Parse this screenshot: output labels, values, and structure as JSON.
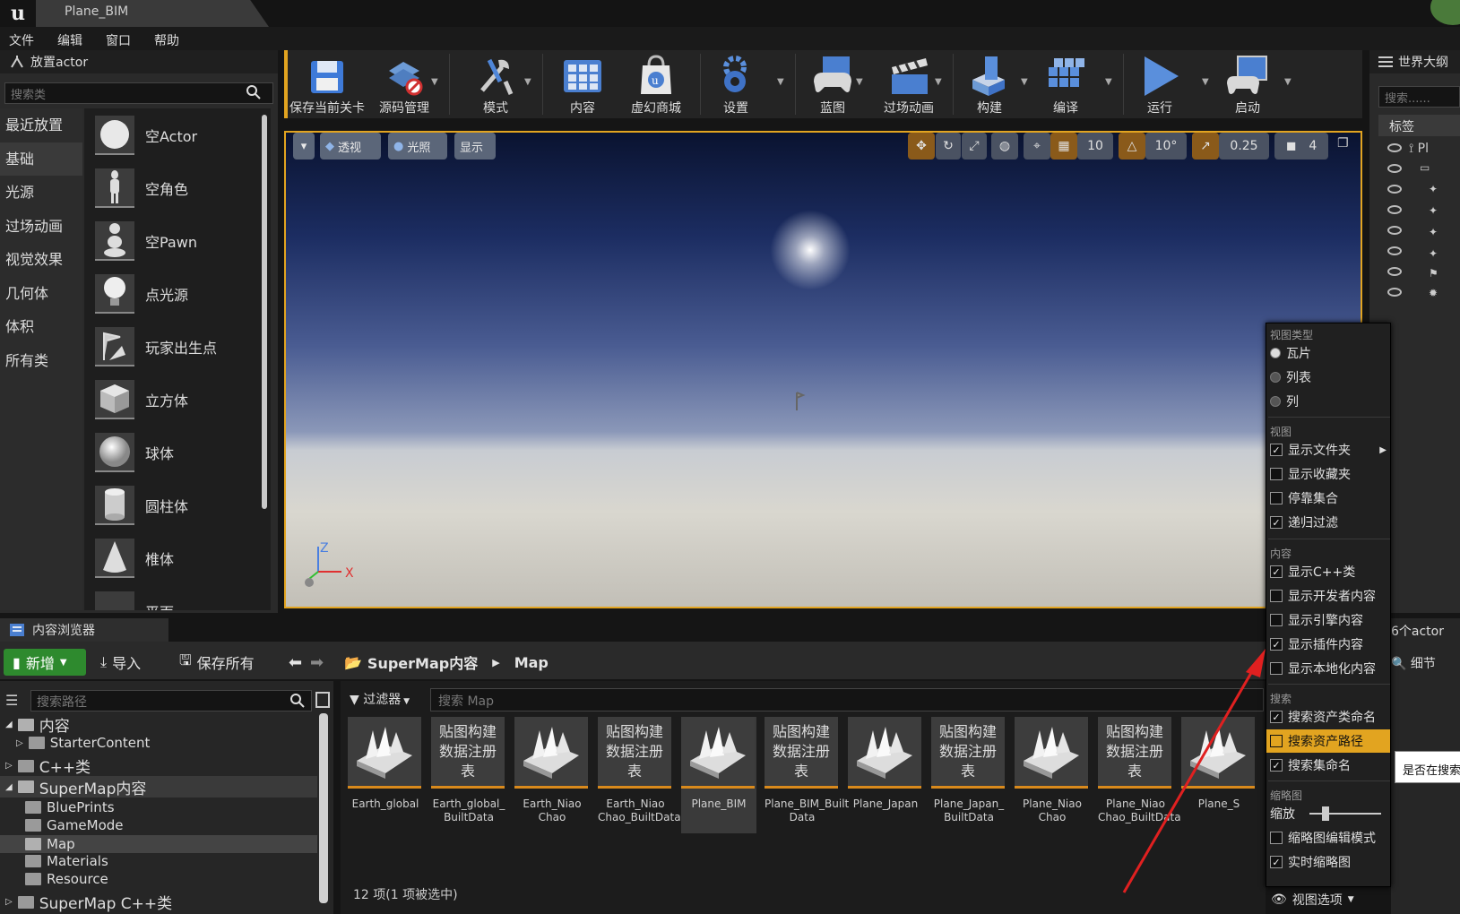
{
  "title": {
    "logo": "u",
    "tab": "Plane_BIM"
  },
  "menu": [
    "文件",
    "编辑",
    "窗口",
    "帮助"
  ],
  "place_actor": {
    "tab": "放置actor",
    "search_placeholder": "搜索类",
    "categories": [
      "最近放置",
      "基础",
      "光源",
      "过场动画",
      "视觉效果",
      "几何体",
      "体积",
      "所有类"
    ],
    "selected_category": "基础",
    "items": [
      "空Actor",
      "空角色",
      "空Pawn",
      "点光源",
      "玩家出生点",
      "立方体",
      "球体",
      "圆柱体",
      "椎体",
      "平面"
    ]
  },
  "toolbar": [
    {
      "label": "保存当前关卡",
      "icon": "save-icon"
    },
    {
      "label": "源码管理",
      "icon": "source-control-icon"
    },
    {
      "label": "模式",
      "icon": "modes-icon"
    },
    {
      "label": "内容",
      "icon": "content-icon"
    },
    {
      "label": "虚幻商城",
      "icon": "marketplace-icon"
    },
    {
      "label": "设置",
      "icon": "settings-icon"
    },
    {
      "label": "蓝图",
      "icon": "blueprint-icon"
    },
    {
      "label": "过场动画",
      "icon": "cinematics-icon"
    },
    {
      "label": "构建",
      "icon": "build-icon"
    },
    {
      "label": "编译",
      "icon": "compile-icon"
    },
    {
      "label": "运行",
      "icon": "play-icon"
    },
    {
      "label": "启动",
      "icon": "launch-icon"
    }
  ],
  "viewport": {
    "perspective": "透视",
    "lighting": "光照",
    "show": "显示",
    "grid_snap": "10",
    "rotation_snap": "10°",
    "scale_snap": "0.25",
    "camera_speed": "4",
    "axis_z": "Z",
    "axis_x": "X"
  },
  "outliner": {
    "tab": "世界大纲",
    "search_placeholder": "搜索......",
    "column": "标签",
    "item_prefix": "Pl",
    "count": "6个actor",
    "details_tab": "细节"
  },
  "context_menu": {
    "view_type_header": "视图类型",
    "view_types": [
      {
        "label": "瓦片",
        "on": true
      },
      {
        "label": "列表",
        "on": false
      },
      {
        "label": "列",
        "on": false
      }
    ],
    "view_header": "视图",
    "view": [
      {
        "label": "显示文件夹",
        "checked": true,
        "submenu": true
      },
      {
        "label": "显示收藏夹",
        "checked": false
      },
      {
        "label": "停靠集合",
        "checked": false
      },
      {
        "label": "递归过滤",
        "checked": true
      }
    ],
    "content_header": "内容",
    "content": [
      {
        "label": "显示C++类",
        "checked": true
      },
      {
        "label": "显示开发者内容",
        "checked": false
      },
      {
        "label": "显示引擎内容",
        "checked": false
      },
      {
        "label": "显示插件内容",
        "checked": true
      },
      {
        "label": "显示本地化内容",
        "checked": false
      }
    ],
    "search_header": "搜索",
    "search": [
      {
        "label": "搜索资产类命名",
        "checked": true
      },
      {
        "label": "搜索资产路径",
        "checked": false,
        "highlight": true
      },
      {
        "label": "搜索集命名",
        "checked": true
      }
    ],
    "thumb_header": "缩略图",
    "zoom_label": "缩放",
    "zoom_level": 0.2,
    "thumb": [
      {
        "label": "缩略图编辑模式",
        "checked": false
      },
      {
        "label": "实时缩略图",
        "checked": true
      }
    ],
    "view_options": "视图选项"
  },
  "tooltip": "是否在搜索",
  "content_browser": {
    "tab": "内容浏览器",
    "new": "新增",
    "import": "导入",
    "save_all": "保存所有",
    "breadcrumb": [
      "SuperMap内容",
      "Map"
    ],
    "path_placeholder": "搜索路径",
    "filter": "过滤器",
    "search_placeholder": "搜索 Map",
    "tree": [
      {
        "label": "内容",
        "level": 0,
        "open": true
      },
      {
        "label": "StarterContent",
        "level": 1
      },
      {
        "label": "C++类",
        "level": 0
      },
      {
        "label": "SuperMap内容",
        "level": 0,
        "open": true
      },
      {
        "label": "BluePrints",
        "level": 1
      },
      {
        "label": "GameMode",
        "level": 1
      },
      {
        "label": "Map",
        "level": 1,
        "selected": true
      },
      {
        "label": "Materials",
        "level": 1
      },
      {
        "label": "Resource",
        "level": 1
      },
      {
        "label": "SuperMap C++类",
        "level": 0
      }
    ],
    "assets": [
      {
        "name": "Earth_global",
        "kind": "map"
      },
      {
        "name": "Earth_global_\nBuiltData",
        "kind": "data"
      },
      {
        "name": "Earth_Niao\nChao",
        "kind": "map"
      },
      {
        "name": "Earth_Niao\nChao_BuiltData",
        "kind": "data"
      },
      {
        "name": "Plane_BIM",
        "kind": "map",
        "selected": true
      },
      {
        "name": "Plane_BIM_Built\nData",
        "kind": "data"
      },
      {
        "name": "Plane_Japan",
        "kind": "map"
      },
      {
        "name": "Plane_Japan_\nBuiltData",
        "kind": "data"
      },
      {
        "name": "Plane_Niao\nChao",
        "kind": "map"
      },
      {
        "name": "Plane_Niao\nChao_BuiltData",
        "kind": "data"
      },
      {
        "name": "Plane_S",
        "kind": "map"
      }
    ],
    "data_thumb_text": "贴图构建\n数据注册\n表",
    "item_count": "12 项(1 项被选中)"
  }
}
